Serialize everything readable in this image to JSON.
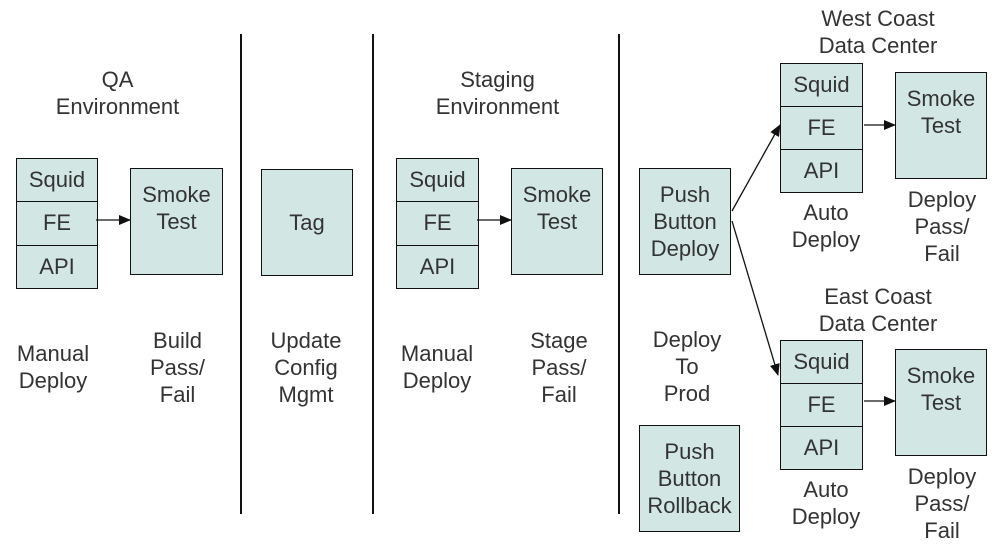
{
  "qa": {
    "title": "QA\nEnvironment",
    "stack": [
      "Squid",
      "FE",
      "API"
    ],
    "smoke": "Smoke\nTest",
    "deploy_label": "Manual\nDeploy",
    "result_label": "Build\nPass/\nFail"
  },
  "tag": {
    "box": "Tag",
    "label": "Update\nConfig\nMgmt"
  },
  "staging": {
    "title": "Staging\nEnvironment",
    "stack": [
      "Squid",
      "FE",
      "API"
    ],
    "smoke": "Smoke\nTest",
    "deploy_label": "Manual\nDeploy",
    "result_label": "Stage\nPass/\nFail"
  },
  "prod": {
    "push_deploy": "Push\nButton\nDeploy",
    "deploy_label": "Deploy\nTo\nProd",
    "push_rollback": "Push\nButton\nRollback",
    "west": {
      "title": "West Coast\nData Center",
      "stack": [
        "Squid",
        "FE",
        "API"
      ],
      "smoke": "Smoke\nTest",
      "deploy_label": "Auto\nDeploy",
      "result_label": "Deploy\nPass/\nFail"
    },
    "east": {
      "title": "East Coast\nData Center",
      "stack": [
        "Squid",
        "FE",
        "API"
      ],
      "smoke": "Smoke\nTest",
      "deploy_label": "Auto\nDeploy",
      "result_label": "Deploy\nPass/\nFail"
    }
  }
}
